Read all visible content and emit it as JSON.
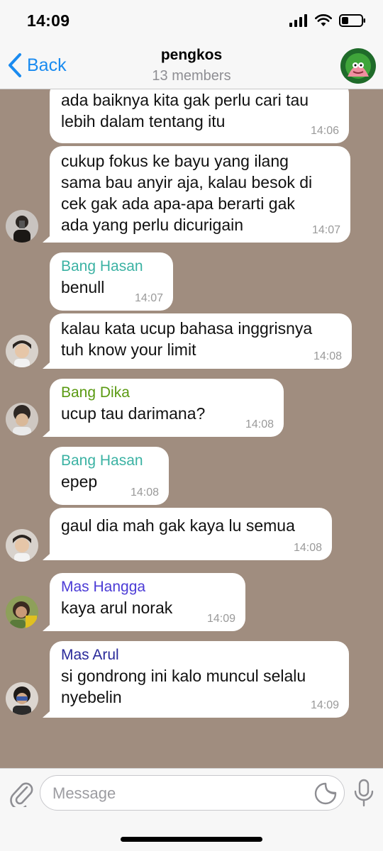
{
  "status_bar": {
    "time": "14:09"
  },
  "header": {
    "back_label": "Back",
    "title": "pengkos",
    "subtitle": "13 members"
  },
  "messages": [
    {
      "sender": "",
      "text": "ada baiknya kita gak perlu cari tau\nlebih dalam tentang itu",
      "time": "14:06"
    },
    {
      "sender": "",
      "text": "cukup fokus ke bayu yang ilang\nsama bau anyir aja, kalau besok di\ncek gak ada apa-apa berarti gak\nada yang perlu dicurigain",
      "time": "14:07"
    },
    {
      "sender": "Bang Hasan",
      "sender_color": "#3bb2a3",
      "text": "benull",
      "time": "14:07"
    },
    {
      "sender": "",
      "text": "kalau kata ucup bahasa inggrisnya\ntuh know your limit",
      "time": "14:08"
    },
    {
      "sender": "Bang Dika",
      "sender_color": "#5a9a12",
      "text": "ucup tau darimana?",
      "time": "14:08"
    },
    {
      "sender": "Bang Hasan",
      "sender_color": "#3bb2a3",
      "text": "epep",
      "time": "14:08"
    },
    {
      "sender": "",
      "text": "gaul dia mah gak kaya lu semua",
      "time": "14:08"
    },
    {
      "sender": "Mas Hangga",
      "sender_color": "#4b3bd6",
      "text": "kaya arul norak",
      "time": "14:09"
    },
    {
      "sender": "Mas Arul",
      "sender_color": "#2a2a9a",
      "text": "si gondrong ini kalo muncul selalu\nnyebelin",
      "time": "14:09"
    }
  ],
  "input": {
    "placeholder": "Message"
  },
  "icons": {
    "back": "chevron-left-icon",
    "attach": "paperclip-icon",
    "sticker": "sticker-icon",
    "mic": "microphone-icon"
  },
  "colors": {
    "accent": "#1a8bf0",
    "chat_background": "#a08d7f",
    "bubble": "#ffffff"
  }
}
